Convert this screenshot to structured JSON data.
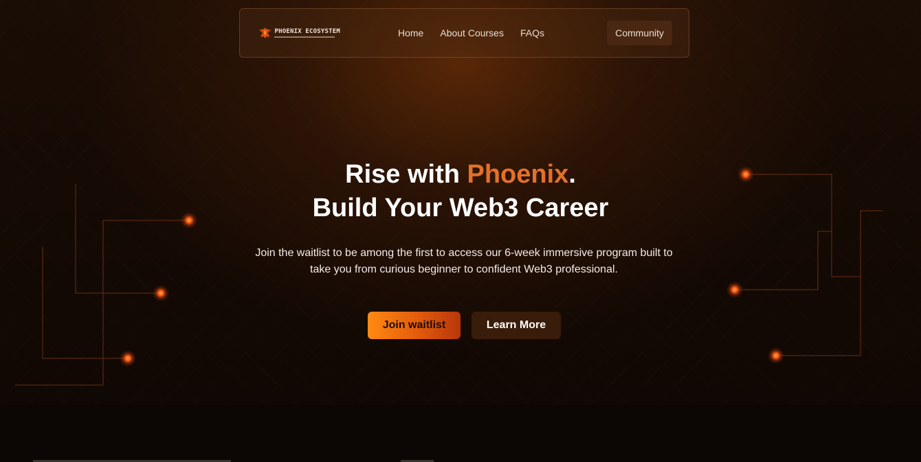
{
  "nav": {
    "logo_title": "PHOENIX ECOSYSTEM",
    "links": [
      {
        "label": "Home"
      },
      {
        "label": "About Courses"
      },
      {
        "label": "FAQs"
      }
    ],
    "community_label": "Community"
  },
  "hero": {
    "headline_prefix": "Rise with ",
    "headline_accent": "Phoenix",
    "headline_suffix": ".",
    "headline_line2": "Build Your Web3 Career",
    "subtext": "Join the waitlist to be among the first to access our 6-week immersive program built to take you from curious beginner to confident Web3 professional.",
    "primary_cta": "Join waitlist",
    "secondary_cta": "Learn More"
  },
  "colors": {
    "accent": "#e2712a",
    "background": "#0c0704",
    "cta_start": "#ff8a12",
    "cta_end": "#b8360c",
    "circuit_line": "#7a3a14",
    "node_glow": "#ff6a10"
  },
  "icons": {
    "logo": "phoenix-bird-icon"
  }
}
